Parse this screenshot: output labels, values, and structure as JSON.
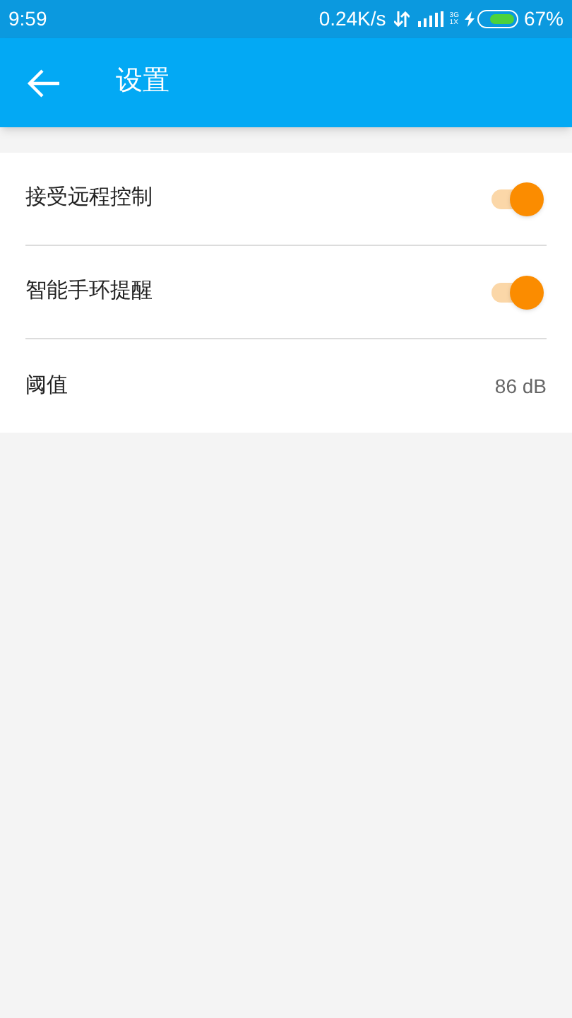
{
  "status_bar": {
    "time": "9:59",
    "speed": "0.24K/s",
    "network_top": "3G",
    "network_bottom": "1X",
    "battery_level_text": "67%"
  },
  "app_bar": {
    "title": "设置"
  },
  "settings": [
    {
      "kind": "toggle",
      "label": "接受远程控制",
      "on": true
    },
    {
      "kind": "toggle",
      "label": "智能手环提醒",
      "on": true
    },
    {
      "kind": "value",
      "label": "阈值",
      "value": "86 dB"
    }
  ]
}
